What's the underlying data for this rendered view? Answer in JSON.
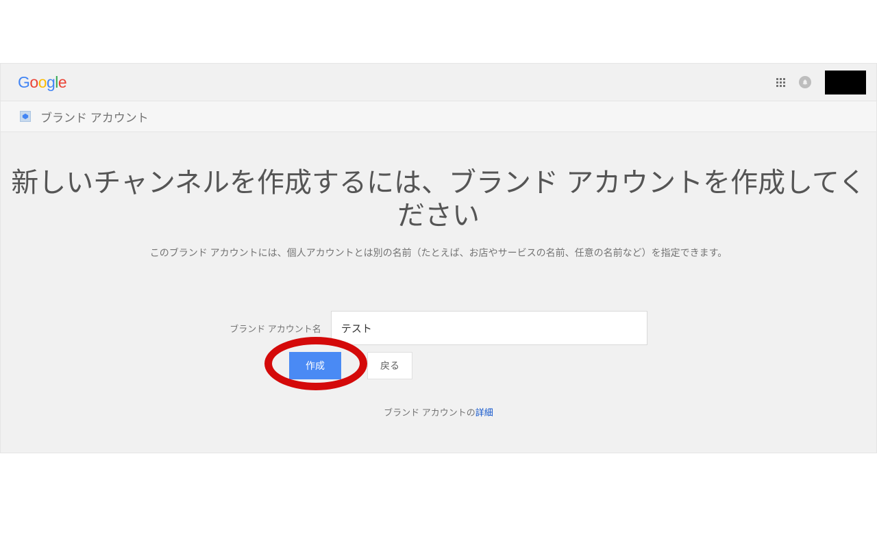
{
  "logo": {
    "text": "Google"
  },
  "breadcrumb": {
    "label": "ブランド アカウント"
  },
  "heading": "新しいチャンネルを作成するには、ブランド アカウントを作成してください",
  "subtext": "このブランド アカウントには、個人アカウントとは別の名前（たとえば、お店やサービスの名前、任意の名前など）を指定できます。",
  "form": {
    "label": "ブランド アカウント名",
    "value": "テスト"
  },
  "buttons": {
    "create": "作成",
    "back": "戻る"
  },
  "footer": {
    "prefix": "ブランド アカウントの",
    "link": "詳細"
  }
}
